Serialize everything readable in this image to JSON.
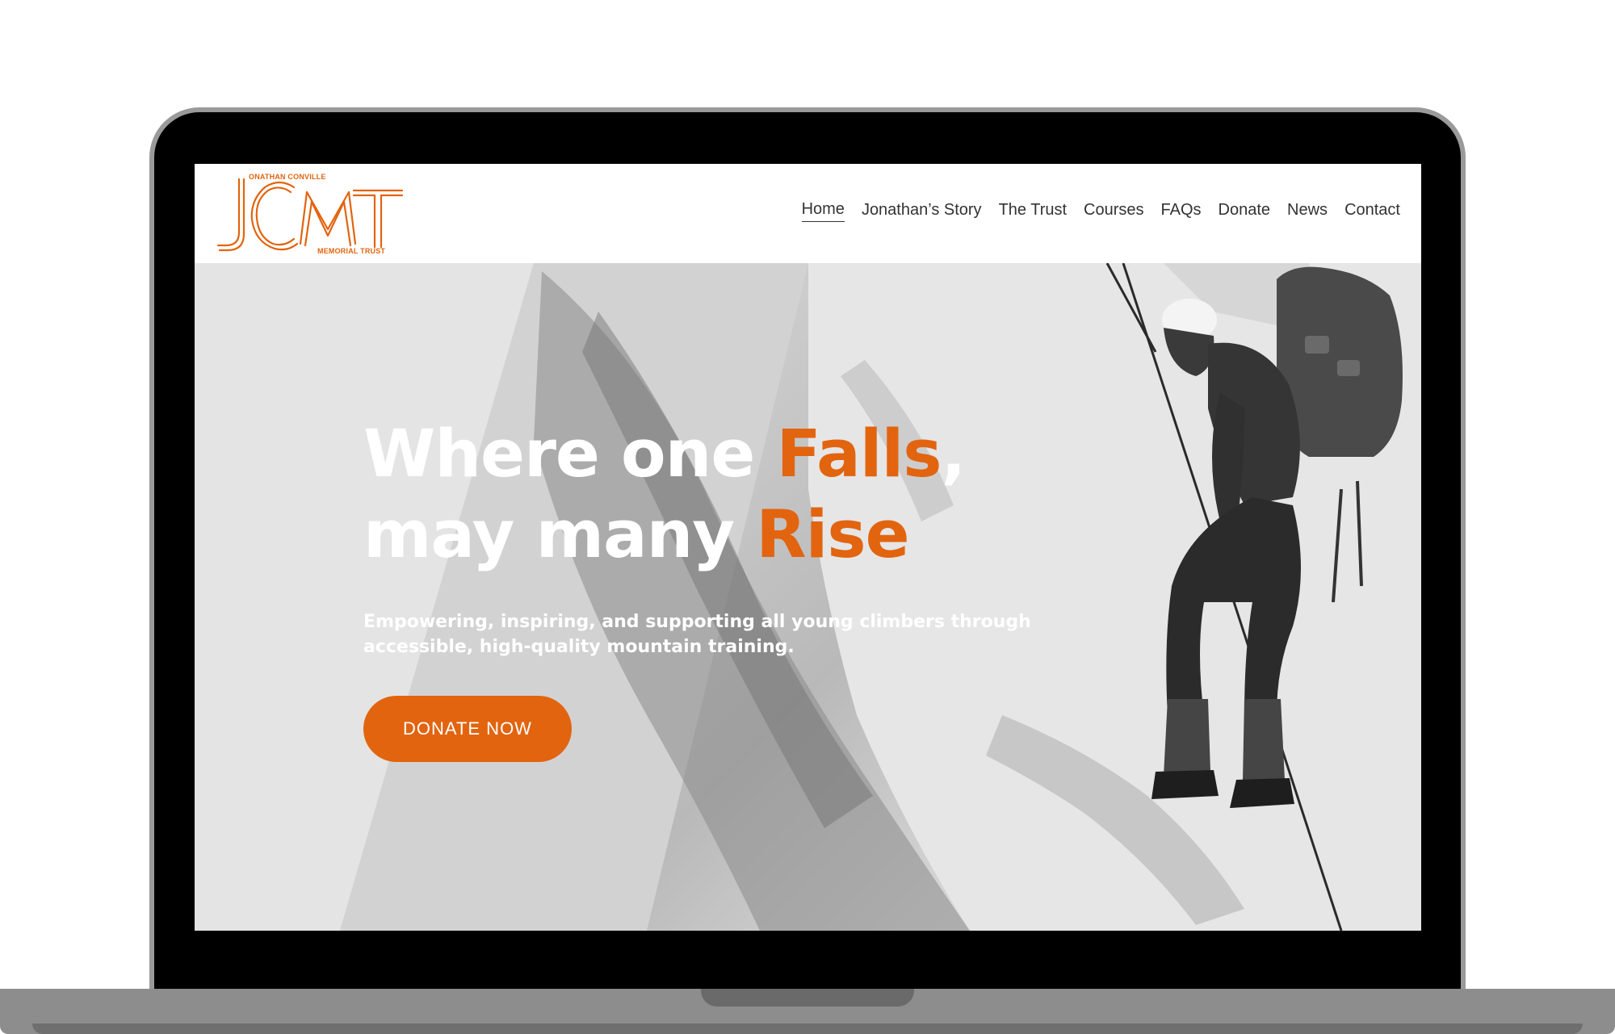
{
  "logo": {
    "top_text": "ONATHAN CONVILLE",
    "bottom_text": "MEMORIAL TRUST",
    "brand_color": "#e2640f"
  },
  "nav": {
    "items": [
      {
        "label": "Home",
        "active": true
      },
      {
        "label": "Jonathan’s Story",
        "active": false
      },
      {
        "label": "The Trust",
        "active": false
      },
      {
        "label": "Courses",
        "active": false
      },
      {
        "label": "FAQs",
        "active": false
      },
      {
        "label": "Donate",
        "active": false
      },
      {
        "label": "News",
        "active": false
      },
      {
        "label": "Contact",
        "active": false
      }
    ]
  },
  "hero": {
    "title_line1_prefix": "Where one ",
    "title_line1_accent": "Falls",
    "title_line1_suffix": ",",
    "title_line2_prefix": "may many ",
    "title_line2_accent": "Rise",
    "subtitle": "Empowering, inspiring, and supporting all young climbers through accessible, high-quality mountain training.",
    "cta_label": "DONATE NOW",
    "accent_color": "#e2640f"
  }
}
